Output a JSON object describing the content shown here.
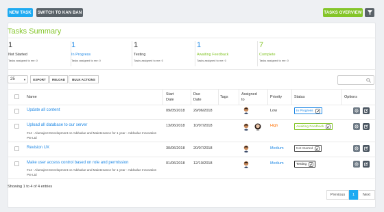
{
  "toolbar": {
    "new_task": "NEW TASK",
    "kanban": "SWITCH TO KAN BAN",
    "overview": "TASKS OVERVIEW"
  },
  "summary": {
    "title": "Tasks Summary",
    "stats": [
      {
        "count": "1",
        "label": "Not Started",
        "sub": "Tasks assigned to me: 0",
        "color": "#333333"
      },
      {
        "count": "1",
        "label": "In Progress",
        "sub": "Tasks assigned to me: 0",
        "color": "#1e88e5"
      },
      {
        "count": "1",
        "label": "Testing",
        "sub": "Tasks assigned to me: 0",
        "color": "#333333"
      },
      {
        "count": "1",
        "label": "Awaiting Feedback",
        "sub": "Tasks assigned to me: 0",
        "color": "#84c529"
      },
      {
        "count": "7",
        "label": "Complete",
        "sub": "Tasks assigned to me: 0",
        "color": "#84c529"
      }
    ]
  },
  "table_controls": {
    "page_length": "25",
    "export": "EXPORT",
    "reload": "RELOAD",
    "bulk": "BULK ACTIONS"
  },
  "table": {
    "headers": {
      "name": "Name",
      "start_date_1": "Start",
      "start_date_2": "Date",
      "due_date_1": "Due",
      "due_date_2": "Date",
      "tags": "Tags",
      "assigned_1": "Assigned",
      "assigned_2": "to",
      "priority": "Priority",
      "status": "Status",
      "options": "Options"
    },
    "rows": [
      {
        "name": "Update all content",
        "sub": "",
        "start": "09/05/2018",
        "due": "29/06/2018",
        "priority": "Low",
        "status": "In Progress"
      },
      {
        "name": "Upload all database to our server",
        "sub": "#14 - Alumaject Development on Addvalue and Maintenance for 1 year - Addvalue Innovation Pte Ltd",
        "start": "13/06/2018",
        "due": "10/07/2018",
        "priority": "High",
        "status": "Awaiting Feedback"
      },
      {
        "name": "Revision UX",
        "sub": "",
        "start": "30/06/2018",
        "due": "20/07/2018",
        "priority": "Medium",
        "status": "Not Started"
      },
      {
        "name": "Make user access control based on role and permission",
        "sub": "#14 - Alumaject Development on Addvalue and Maintenance for 1 year - Addvalue Innovation Pte Ltd",
        "start": "01/06/2018",
        "due": "12/10/2018",
        "priority": "Medium",
        "status": "Testing"
      }
    ]
  },
  "footer": {
    "entries": "Showing 1 to 4 of 4 entries",
    "prev": "Previous",
    "page": "1",
    "next": "Next"
  },
  "colors": {
    "accent_blue": "#1eaaf1",
    "green": "#84c529",
    "orange": "#ff6f00",
    "dark": "#5a6268"
  }
}
